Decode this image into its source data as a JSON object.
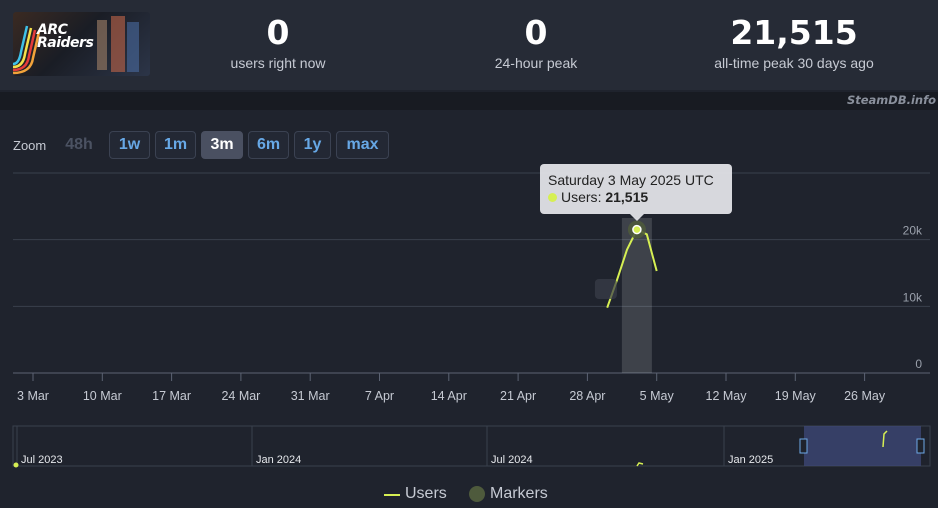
{
  "app": {
    "logo_text": "ARC Raiders",
    "brand": "SteamDB.info"
  },
  "stats": [
    {
      "value": "0",
      "label": "users right now"
    },
    {
      "value": "0",
      "label": "24-hour peak"
    },
    {
      "value": "21,515",
      "label": "all-time peak 30 days ago"
    }
  ],
  "zoom": {
    "label": "Zoom",
    "buttons": [
      {
        "label": "48h",
        "state": "disabled"
      },
      {
        "label": "1w",
        "state": "normal"
      },
      {
        "label": "1m",
        "state": "normal"
      },
      {
        "label": "3m",
        "state": "active"
      },
      {
        "label": "6m",
        "state": "normal"
      },
      {
        "label": "1y",
        "state": "normal"
      },
      {
        "label": "max",
        "state": "normal"
      }
    ]
  },
  "tooltip": {
    "date": "Saturday 3 May 2025 UTC",
    "series": "Users",
    "value": "21,515"
  },
  "chart_data": {
    "type": "line",
    "title": "",
    "xlabel": "",
    "ylabel": "",
    "x_tick_labels": [
      "3 Mar",
      "10 Mar",
      "17 Mar",
      "24 Mar",
      "31 Mar",
      "7 Apr",
      "14 Apr",
      "21 Apr",
      "28 Apr",
      "5 May",
      "12 May",
      "19 May",
      "26 May"
    ],
    "y_tick_labels": [
      "0",
      "10k",
      "20k"
    ],
    "ylim": [
      0,
      30000
    ],
    "grid": true,
    "legend": [
      "Users",
      "Markers"
    ],
    "legend_position": "bottom-center",
    "series": [
      {
        "name": "Users",
        "points": [
          {
            "x": "2025-04-30",
            "y": 9800
          },
          {
            "x": "2025-05-01",
            "y": 14000
          },
          {
            "x": "2025-05-02",
            "y": 18500
          },
          {
            "x": "2025-05-03",
            "y": 21515
          },
          {
            "x": "2025-05-04",
            "y": 20800
          },
          {
            "x": "2025-05-05",
            "y": 15300
          }
        ]
      }
    ],
    "highlight": {
      "x": "2025-05-03",
      "y": 21515
    },
    "navigator": {
      "tick_labels": [
        "Jul 2023",
        "Jan 2024",
        "Jul 2024",
        "Jan 2025"
      ]
    },
    "colors": {
      "users": "#d6ef53",
      "markers": "#4e5a3c",
      "background": "#1f232d"
    }
  }
}
